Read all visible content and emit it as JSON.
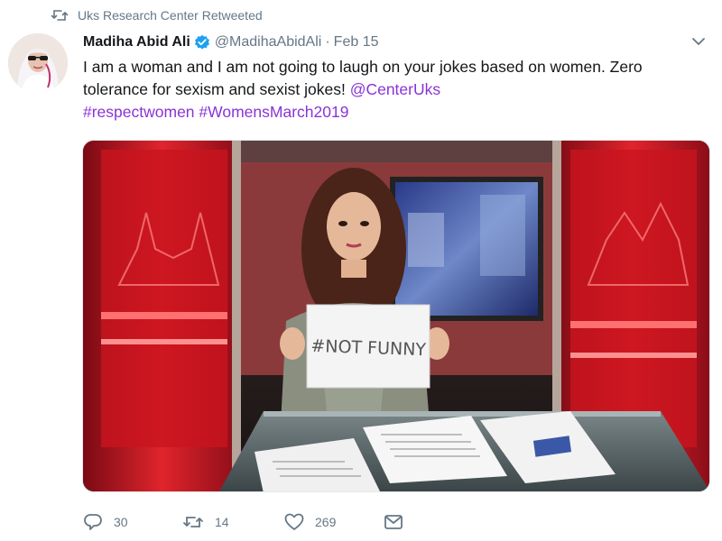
{
  "retweet_context": {
    "icon": "retweet-icon",
    "text": "Uks Research Center Retweeted"
  },
  "tweet": {
    "author_name": "Madiha Abid Ali",
    "verified_icon": "verified-badge-icon",
    "handle": "@MadihaAbidAli",
    "separator": "·",
    "date": "Feb 15",
    "text_lines": [
      "I am a woman and I am not going to laugh on your jokes based on women. Zero",
      "tolerance for sexism and sexist jokes! "
    ],
    "mention": "@CenterUks",
    "hashtags": [
      "#respectwomen",
      "#WomensMarch2019"
    ],
    "menu_icon": "chevron-down-icon"
  },
  "media": {
    "sign_text": "#NOT FUNNY"
  },
  "actions": {
    "reply_count": "30",
    "retweet_count": "14",
    "like_count": "269",
    "message_icon": "envelope-icon"
  },
  "colors": {
    "link": "#8a33d6",
    "muted": "#657786",
    "verified": "#1da1f2",
    "studio_red": "#c8102e"
  }
}
